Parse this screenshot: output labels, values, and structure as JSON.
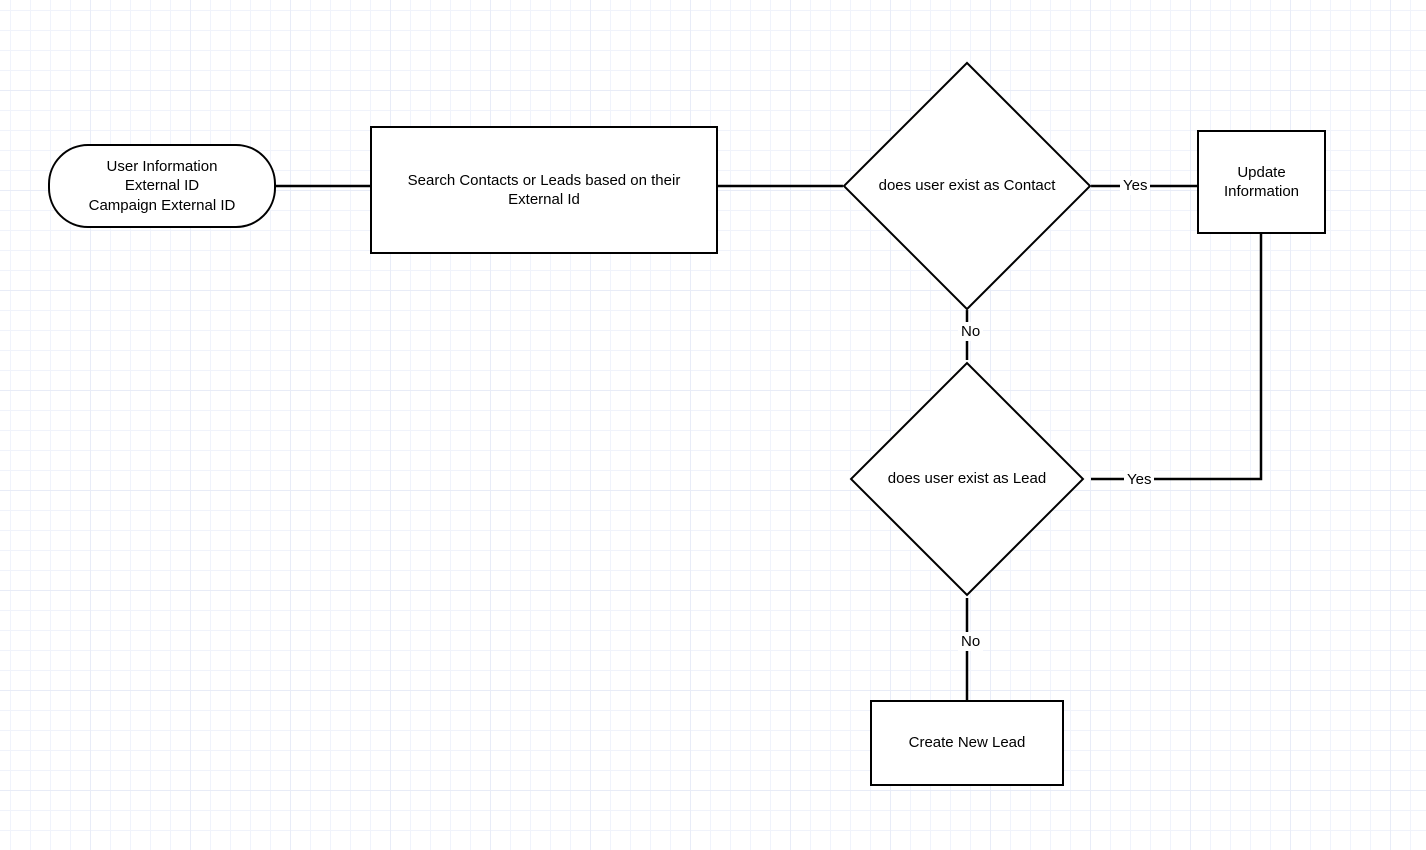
{
  "nodes": {
    "start": {
      "line1": "User Information",
      "line2": "External ID",
      "line3": "Campaign External ID"
    },
    "search": "Search Contacts or Leads based on their External Id",
    "decision_contact": "does user exist as Contact",
    "decision_lead": "does user exist as Lead",
    "update": "Update Information",
    "create": "Create New Lead"
  },
  "edges": {
    "yes": "Yes",
    "no": "No"
  }
}
